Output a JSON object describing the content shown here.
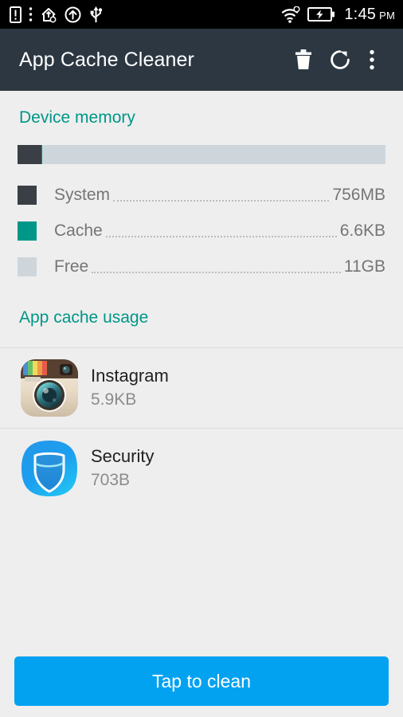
{
  "status_bar": {
    "icons": [
      "sim-alert-icon",
      "more-vertical-icon",
      "home-upload-icon",
      "arrow-up-circle-icon",
      "usb-icon"
    ],
    "right_icons": [
      "wifi-icon",
      "battery-charging-icon"
    ],
    "time": "1:45",
    "ampm": "PM",
    "background": "#000000"
  },
  "app_bar": {
    "title": "App Cache Cleaner",
    "background": "#2c3742",
    "actions": [
      {
        "name": "delete-icon",
        "label": "Delete"
      },
      {
        "name": "refresh-icon",
        "label": "Refresh"
      },
      {
        "name": "overflow-menu-icon",
        "label": "More options"
      }
    ]
  },
  "device_memory": {
    "title": "Device memory",
    "accent": "#009688",
    "bar": {
      "track_color": "#ced6dc",
      "segments": [
        {
          "name": "System",
          "color": "#393f45",
          "percent": 6.5
        },
        {
          "name": "Cache",
          "color": "#009688",
          "percent": 0.2
        }
      ]
    },
    "legend": [
      {
        "label": "System",
        "value": "756MB",
        "color": "#393f45"
      },
      {
        "label": "Cache",
        "value": "6.6KB",
        "color": "#009688"
      },
      {
        "label": "Free",
        "value": "11GB",
        "color": "#ced6dc"
      }
    ]
  },
  "app_cache_usage": {
    "title": "App cache usage",
    "apps": [
      {
        "name": "Instagram",
        "size": "5.9KB",
        "icon": "instagram-icon"
      },
      {
        "name": "Security",
        "size": "703B",
        "icon": "security-shield-icon"
      }
    ]
  },
  "clean_button": {
    "label": "Tap to clean",
    "color": "#03a2f0"
  }
}
